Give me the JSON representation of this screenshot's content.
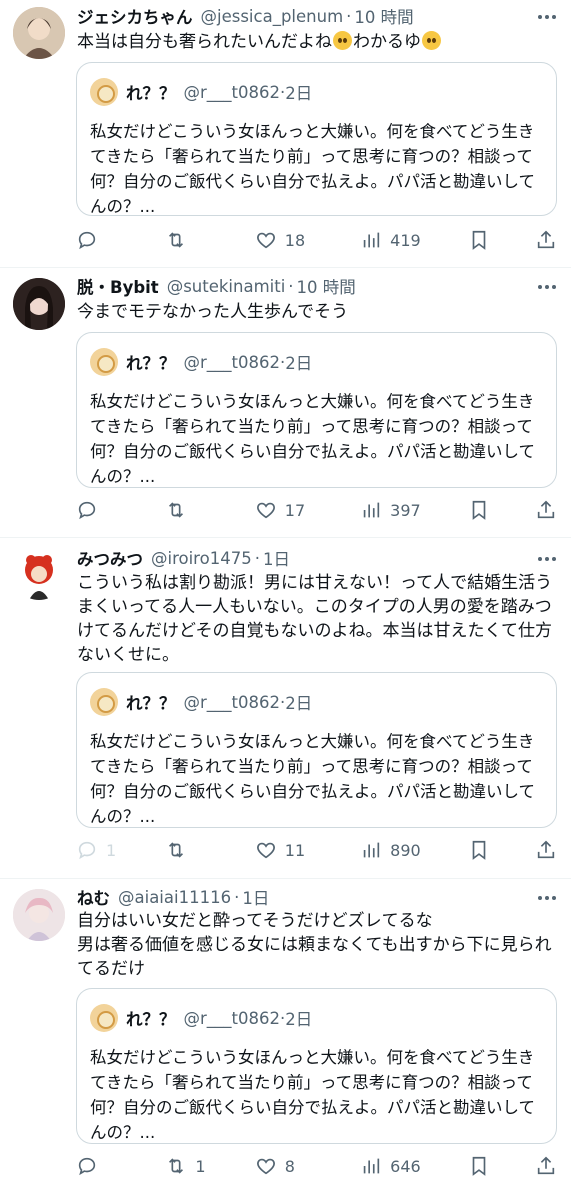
{
  "tweets": [
    {
      "name": "ジェシカちゃん",
      "handle": "@jessica_plenum",
      "sep": "·",
      "time": "10 時間",
      "body_before": "本当は自分も奢られたいんだよね",
      "body_mid": "わかるゆ",
      "avatar_color": "#c9b49a",
      "quote": {
        "name": "れ？？",
        "handle": "@r___t0862",
        "sep": "·",
        "time": "2日",
        "text": "私女だけどこういう女ほんっと大嫌い。何を食べてどう生きてきたら「奢られて当たり前」って思考に育つの？相談って何？自分のご飯代くらい自分で払えよ。パパ活と勘違いしてんの？..."
      },
      "reply_count": "",
      "retweet_count": "",
      "like_count": "18",
      "view_count": "419"
    },
    {
      "name": "脱・Bybit",
      "handle": "@sutekinamiti",
      "sep": "·",
      "time": "10 時間",
      "body": "今までモテなかった人生歩んでそう",
      "avatar_color": "#3a2e2a",
      "quote": {
        "name": "れ？？",
        "handle": "@r___t0862",
        "sep": "·",
        "time": "2日",
        "text": "私女だけどこういう女ほんっと大嫌い。何を食べてどう生きてきたら「奢られて当たり前」って思考に育つの？相談って何？自分のご飯代くらい自分で払えよ。パパ活と勘違いしてんの？..."
      },
      "reply_count": "",
      "retweet_count": "",
      "like_count": "17",
      "view_count": "397"
    },
    {
      "name": "みつみつ",
      "handle": "@iroiro1475",
      "sep": "·",
      "time": "1日",
      "body": "こういう私は割り勘派！男には甘えない！って人で結婚生活うまくいってる人一人もいない。このタイプの人男の愛を踏みつけてるんだけどその自覚もないのよね。本当は甘えたくて仕方ないくせに。",
      "avatar_color": "#d6301f",
      "quote": {
        "name": "れ？？",
        "handle": "@r___t0862",
        "sep": "·",
        "time": "2日",
        "text": "私女だけどこういう女ほんっと大嫌い。何を食べてどう生きてきたら「奢られて当たり前」って思考に育つの？相談って何？自分のご飯代くらい自分で払えよ。パパ活と勘違いしてんの？..."
      },
      "reply_count": "1",
      "retweet_count": "",
      "like_count": "11",
      "view_count": "890"
    },
    {
      "name": "ねむ",
      "handle": "@aiaiai11116",
      "sep": "·",
      "time": "1日",
      "body": "自分はいい女だと酔ってそうだけどズレてるな\n男は奢る価値を感じる女には頼まなくても出すから下に見られてるだけ",
      "avatar_color": "#e6d8da",
      "quote": {
        "name": "れ？？",
        "handle": "@r___t0862",
        "sep": "·",
        "time": "2日",
        "text": "私女だけどこういう女ほんっと大嫌い。何を食べてどう生きてきたら「奢られて当たり前」って思考に育つの？相談って何？自分のご飯代くらい自分で払えよ。パパ活と勘違いしてんの？..."
      },
      "reply_count": "",
      "retweet_count": "1",
      "like_count": "8",
      "view_count": "646"
    }
  ]
}
